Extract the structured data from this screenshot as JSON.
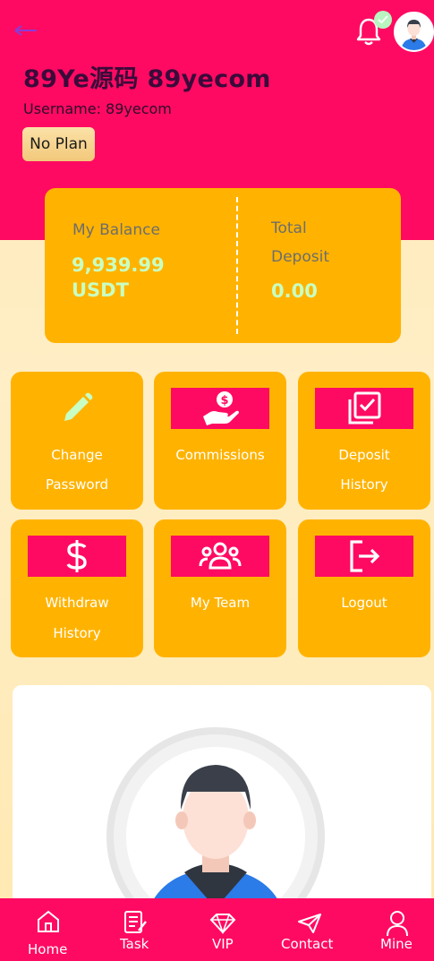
{
  "header": {
    "title": "89Ye源码 89yecom",
    "username_line": "Username: 89yecom",
    "plan_badge": "No Plan",
    "back_icon": "back-arrow-icon",
    "bell_icon": "bell-icon",
    "online_badge_icon": "check-icon"
  },
  "balance": {
    "my_balance_label": "My Balance",
    "my_balance_amount": "9,939.99",
    "my_balance_currency": "USDT",
    "total_deposit_label_line1": "Total",
    "total_deposit_label_line2": "Deposit",
    "total_deposit_value": "0.00"
  },
  "menu": {
    "change_password": {
      "line1": "Change",
      "line2": "Password",
      "icon": "pencil-icon"
    },
    "commissions": {
      "line1": "Commissions",
      "icon": "hand-coin-icon"
    },
    "deposit_history": {
      "line1": "Deposit",
      "line2": "History",
      "icon": "checklist-icon"
    },
    "withdraw_history": {
      "line1": "Withdraw",
      "line2": "History",
      "icon": "dollar-icon"
    },
    "my_team": {
      "line1": "My Team",
      "icon": "team-icon"
    },
    "logout": {
      "line1": "Logout",
      "icon": "logout-icon"
    }
  },
  "nav": {
    "home": "Home",
    "task": "Task",
    "vip": "VIP",
    "contact": "Contact",
    "mine": "Mine"
  },
  "colors": {
    "primary": "#ff0a62",
    "card": "#ffb300",
    "accent_green": "#c9ffc2",
    "background": "#ffe9b5"
  }
}
